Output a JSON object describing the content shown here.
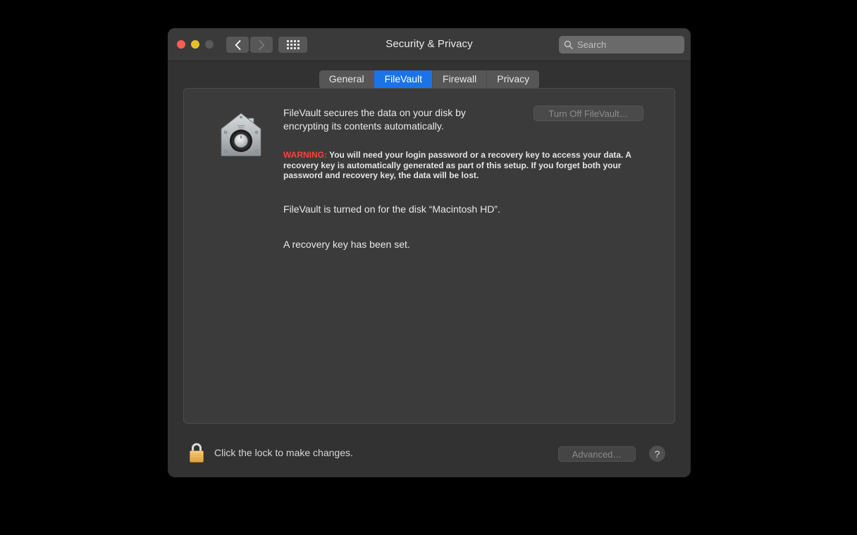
{
  "window": {
    "title": "Security & Privacy",
    "traffic_lights": [
      {
        "name": "close",
        "color": "#fa5e57"
      },
      {
        "name": "minimize",
        "color": "#e4c02c"
      },
      {
        "name": "zoom",
        "color": "#5a5a5a"
      }
    ],
    "toolbar": {
      "back_icon": "chevron-left-icon",
      "forward_icon": "chevron-right-icon",
      "show_all_icon": "grid-icon"
    },
    "search": {
      "icon": "search-icon",
      "placeholder": "Search",
      "value": ""
    }
  },
  "tabs": [
    {
      "label": "General",
      "active": false
    },
    {
      "label": "FileVault",
      "active": true
    },
    {
      "label": "Firewall",
      "active": false
    },
    {
      "label": "Privacy",
      "active": false
    }
  ],
  "accent_color": "#1a74e8",
  "warning_color": "#f6453c",
  "filevault": {
    "icon": "filevault-house-safe-icon",
    "description": "FileVault secures the data on your disk by encrypting its contents automatically.",
    "warning_label": "WARNING:",
    "warning_body": " You will need your login password or a recovery key to access your data. A recovery key is automatically generated as part of this setup. If you forget both your password and recovery key, the data will be lost.",
    "turn_off_button": "Turn Off FileVault…",
    "turn_off_enabled": false,
    "status_disk": "FileVault is turned on for the disk “Macintosh HD”.",
    "status_recovery_key": "A recovery key has been set."
  },
  "footer": {
    "lock_icon": "lock-closed-icon",
    "lock_text": "Click the lock to make changes.",
    "advanced_button": "Advanced…",
    "advanced_enabled": false,
    "help_button": "?"
  }
}
